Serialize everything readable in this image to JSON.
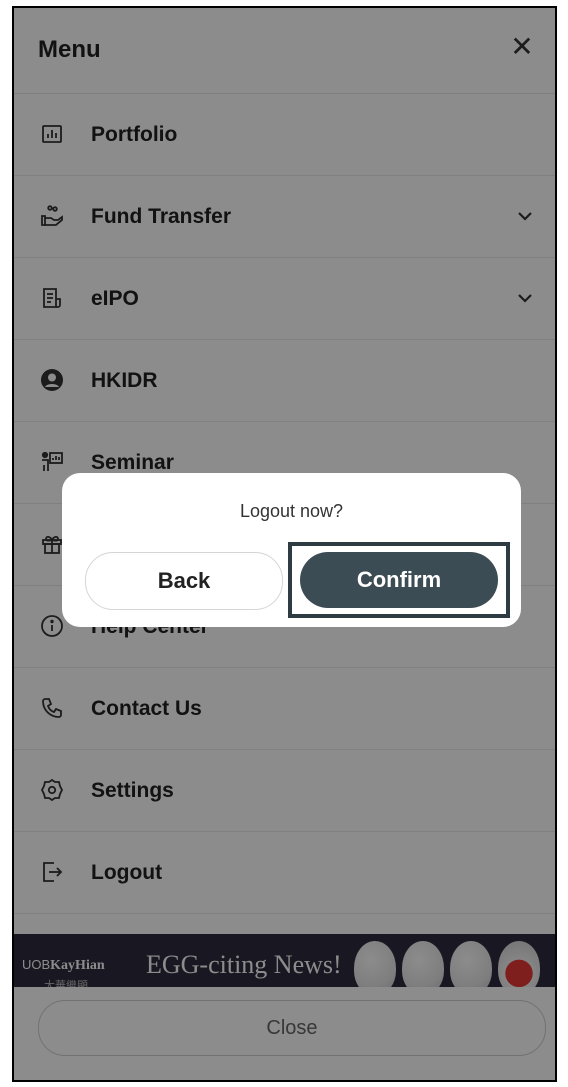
{
  "header": {
    "title": "Menu",
    "close_symbol": "✕"
  },
  "menu": {
    "items": [
      {
        "label": "Portfolio",
        "icon": "bar-chart-icon",
        "expandable": false
      },
      {
        "label": "Fund Transfer",
        "icon": "hand-coins-icon",
        "expandable": true
      },
      {
        "label": "eIPO",
        "icon": "document-icon",
        "expandable": true
      },
      {
        "label": "HKIDR",
        "icon": "user-circle-icon",
        "expandable": false
      },
      {
        "label": "Seminar",
        "icon": "presenter-icon",
        "expandable": false
      },
      {
        "label": "",
        "icon": "gift-icon",
        "expandable": false
      },
      {
        "label": "Help Center",
        "icon": "info-icon",
        "expandable": false
      },
      {
        "label": "Contact Us",
        "icon": "phone-icon",
        "expandable": false
      },
      {
        "label": "Settings",
        "icon": "gear-icon",
        "expandable": false
      },
      {
        "label": "Logout",
        "icon": "logout-icon",
        "expandable": false
      }
    ]
  },
  "banner": {
    "brand_prefix": "UOB",
    "brand_name": "KayHian",
    "brand_cn": "大華繼顯",
    "headline": "EGG-citing News!",
    "badge_letter": "u"
  },
  "footer": {
    "close_label": "Close"
  },
  "dialog": {
    "message": "Logout now?",
    "back_label": "Back",
    "confirm_label": "Confirm"
  },
  "colors": {
    "confirm": "#3c4c54",
    "banner_bg": "#2e2c3f",
    "overlay": "rgba(0,0,0,0.45)"
  }
}
